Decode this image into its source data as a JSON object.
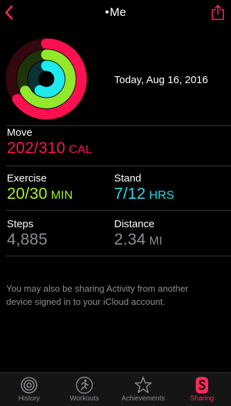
{
  "nav": {
    "title_dot": "•",
    "title": "Me"
  },
  "rings": {
    "move_progress": 0.652,
    "exercise_progress": 0.667,
    "stand_progress": 0.583,
    "colors": {
      "move": "#fa114f",
      "exercise": "#92e82a",
      "stand": "#1eeaef"
    }
  },
  "date": "Today, Aug 16, 2016",
  "move": {
    "label": "Move",
    "value": "202/310",
    "unit": "CAL",
    "color": "#fa114f"
  },
  "exercise": {
    "label": "Exercise",
    "value": "20/30",
    "unit": "MIN",
    "color": "#a5f228"
  },
  "stand": {
    "label": "Stand",
    "value": "7/12",
    "unit": "HRS",
    "color": "#25d9e3"
  },
  "steps": {
    "label": "Steps",
    "value": "4,885",
    "color": "#8e8e93"
  },
  "distance": {
    "label": "Distance",
    "value": "2.34",
    "unit": "MI",
    "color": "#8e8e93"
  },
  "note": "You may also be sharing Activity from another device signed in to your iCloud account.",
  "tabs": [
    {
      "label": "History",
      "icon": "history-rings-icon"
    },
    {
      "label": "Workouts",
      "icon": "workout-runner-icon"
    },
    {
      "label": "Achievements",
      "icon": "achievement-star-icon"
    },
    {
      "label": "Sharing",
      "icon": "sharing-icon"
    }
  ]
}
